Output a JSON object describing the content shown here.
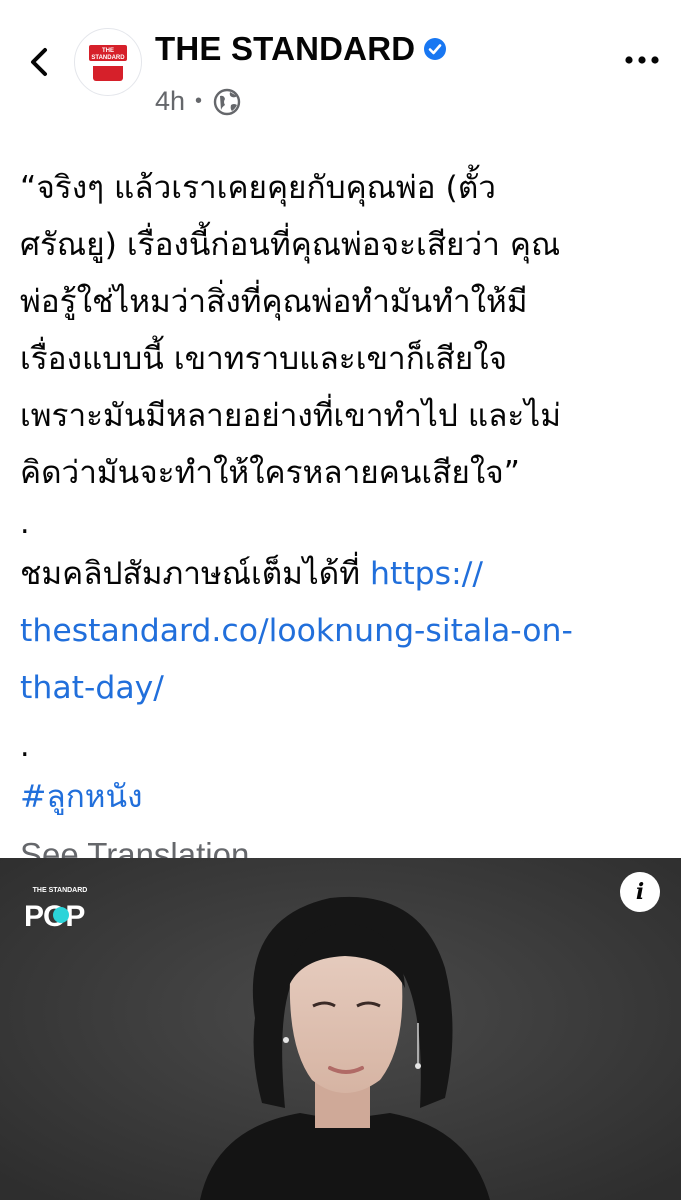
{
  "header": {
    "page_name": "THE STANDARD",
    "time_ago": "4h",
    "avatar_text_top": "THE",
    "avatar_text_bottom": "STANDARD"
  },
  "post": {
    "quote_lines": [
      "“จริงๆ แล้วเราเคยคุยกับคุณพ่อ (ตั้ว",
      "ศรัณยู) เรื่องนี้ก่อนที่คุณพ่อจะเสียว่า คุณ",
      "พ่อรู้ใช่ไหมว่าสิ่งที่คุณพ่อทำมันทำให้มี",
      "เรื่องแบบนี้ เขาทราบและเขาก็เสียใจ",
      "เพราะมันมีหลายอย่างที่เขาทำไป และไม่",
      "คิดว่ามันจะทำให้ใครหลายคนเสียใจ”"
    ],
    "separator_1": ".",
    "clip_prefix": "ชมคลิปสัมภาษณ์เต็มได้ที่ ",
    "link_lines": [
      "https://",
      "thestandard.co/looknung-sitala-on-",
      "that-day/"
    ],
    "separator_2": ".",
    "hashtag": "#ลูกหนัง",
    "see_translation": "See Translation"
  },
  "media": {
    "logo_small": "THE STANDARD",
    "logo_main": "POP",
    "info_label": "i"
  },
  "colors": {
    "link": "#216fdb",
    "secondary_text": "#65676b",
    "brand_red": "#d6202a",
    "verified_blue": "#1877f2",
    "pop_cyan": "#2bd4d9"
  }
}
